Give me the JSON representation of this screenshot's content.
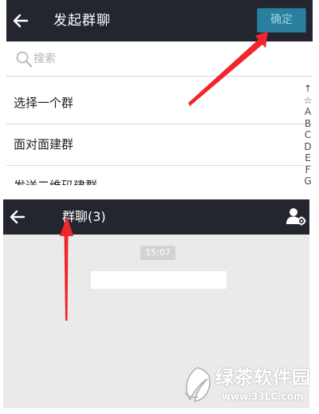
{
  "top_screen": {
    "title": "发起群聊",
    "confirm_label": "确定",
    "search_placeholder": "搜索",
    "list_items": [
      {
        "label": "选择一个群"
      },
      {
        "label": "面对面建群"
      },
      {
        "label": "发送二维码建群"
      }
    ],
    "index_letters": [
      "↑",
      "☆",
      "A",
      "B",
      "C",
      "D",
      "E",
      "F",
      "G"
    ],
    "colors": {
      "header": "#23262f",
      "confirm_button": "#2a7e9e"
    },
    "icons": {
      "back": "arrow-left-icon",
      "search": "magnifier-icon"
    }
  },
  "bottom_screen": {
    "title": "群聊(3)",
    "time": "15:07",
    "colors": {
      "header": "#23262f",
      "chat_background": "#eaeaea"
    },
    "icons": {
      "back": "arrow-left-icon",
      "members": "group-settings-icon"
    }
  },
  "annotations": {
    "arrow_color": "#f0262c"
  },
  "watermark": {
    "name": "绿茶软件园",
    "url": "www.33LC.com"
  }
}
